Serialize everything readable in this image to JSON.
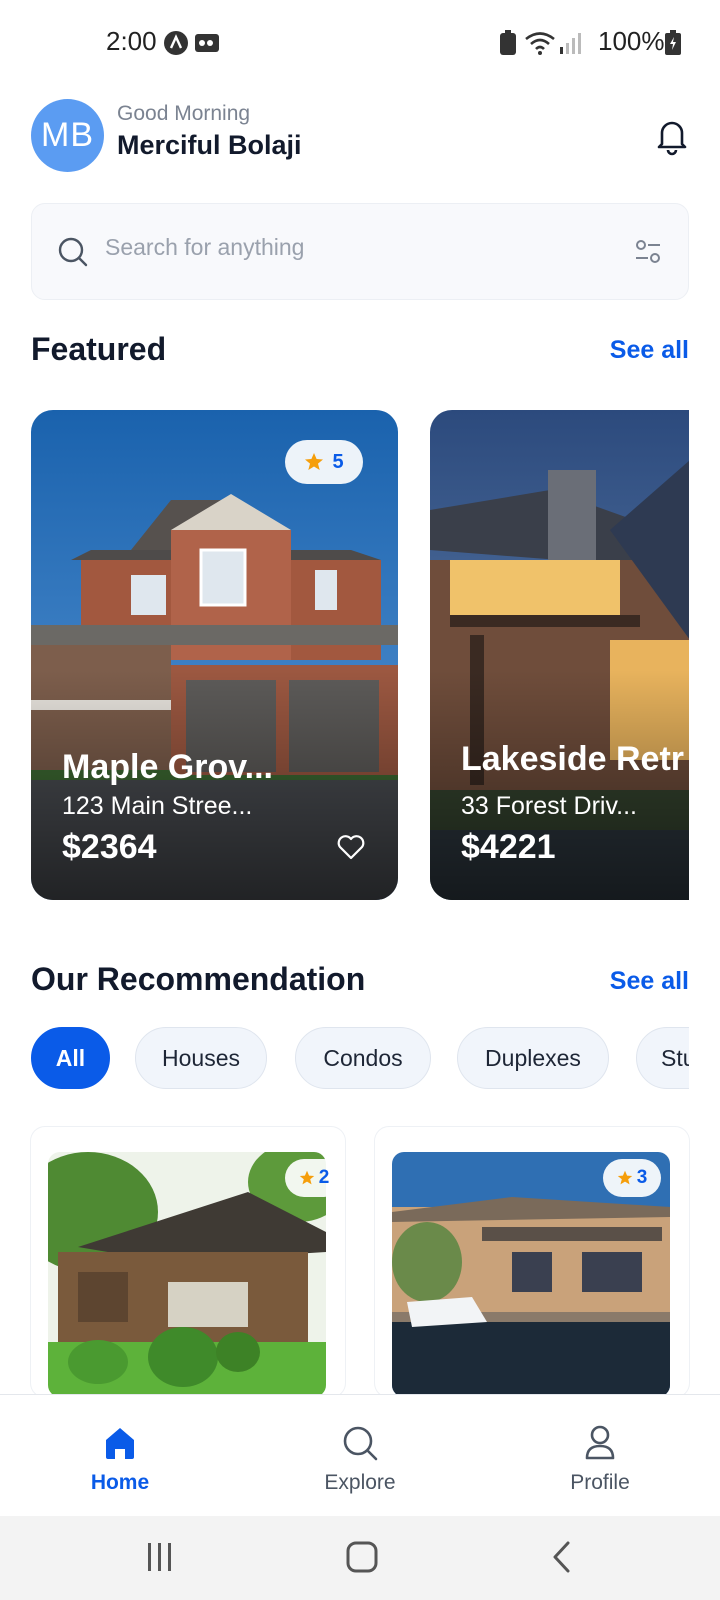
{
  "status_bar": {
    "time": "2:00",
    "battery": "100%"
  },
  "header": {
    "avatar_initials": "MB",
    "greeting": "Good Morning",
    "user_name": "Merciful Bolaji"
  },
  "search": {
    "placeholder": "Search for anything"
  },
  "featured": {
    "title": "Featured",
    "see_all": "See all",
    "cards": [
      {
        "title": "Maple Grov...",
        "address": "123 Main Stree...",
        "price": "$2364",
        "rating": "5"
      },
      {
        "title": "Lakeside Retr",
        "address": "33 Forest Driv...",
        "price": "$4221"
      }
    ]
  },
  "recommendation": {
    "title": "Our Recommendation",
    "see_all": "See all",
    "filters": [
      "All",
      "Houses",
      "Condos",
      "Duplexes",
      "Stu"
    ],
    "cards": [
      {
        "rating": "2"
      },
      {
        "rating": "3"
      }
    ]
  },
  "bottom_nav": {
    "items": [
      {
        "label": "Home"
      },
      {
        "label": "Explore"
      },
      {
        "label": "Profile"
      }
    ]
  },
  "colors": {
    "accent": "#0a5be8",
    "star": "#f59e0b",
    "avatar": "#5b9cf2"
  }
}
